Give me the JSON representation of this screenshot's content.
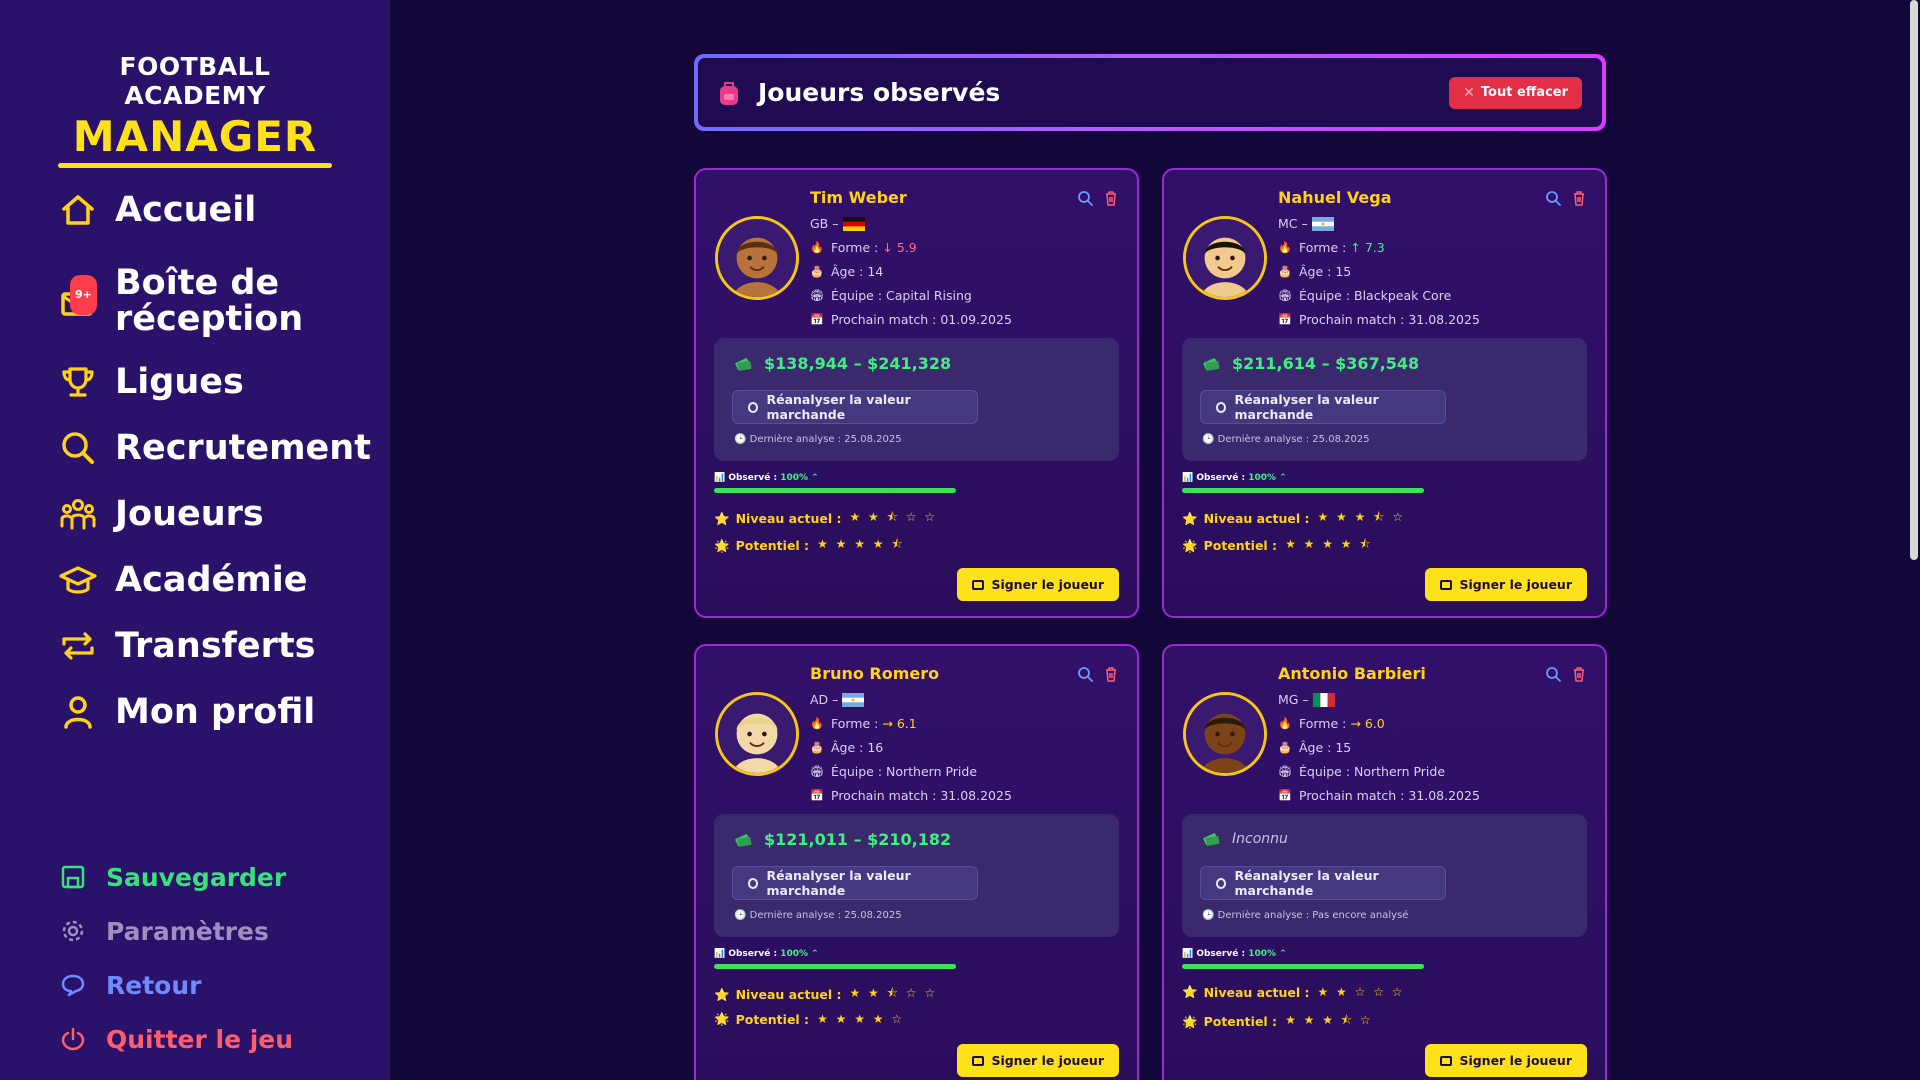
{
  "sidebar": {
    "logo_top": "FOOTBALL ACADEMY",
    "logo_main": "MANAGER",
    "nav": [
      {
        "label": "Accueil",
        "icon": "home-icon"
      },
      {
        "label": "Boîte de réception",
        "icon": "mail-icon",
        "badge": "9+"
      },
      {
        "label": "Ligues",
        "icon": "trophy-icon"
      },
      {
        "label": "Recrutement",
        "icon": "search-icon"
      },
      {
        "label": "Joueurs",
        "icon": "players-icon"
      },
      {
        "label": "Académie",
        "icon": "graduation-cap-icon"
      },
      {
        "label": "Transferts",
        "icon": "transfer-icon"
      },
      {
        "label": "Mon profil",
        "icon": "user-icon"
      }
    ],
    "bottom": [
      {
        "label": "Sauvegarder",
        "icon": "save-icon",
        "color": "#37e27a"
      },
      {
        "label": "Paramètres",
        "icon": "gear-icon",
        "color": "#9d8fc0"
      },
      {
        "label": "Retour",
        "icon": "feedback-icon",
        "color": "#6c8bff"
      },
      {
        "label": "Quitter le jeu",
        "icon": "power-icon",
        "color": "#ff5d6b"
      }
    ]
  },
  "header": {
    "title": "Joueurs observés",
    "clear_label": "Tout effacer"
  },
  "labels": {
    "forme": "Forme :",
    "age": "Âge :",
    "equipe": "Équipe :",
    "prochain": "Prochain match :",
    "reanalyze": "Réanalyser la valeur marchande",
    "derniere": "Dernière analyse :",
    "observe": "Observé :",
    "niveau": "Niveau actuel :",
    "potentiel": "Potentiel :",
    "sign": "Signer le joueur"
  },
  "players": [
    {
      "name": "Tim Weber",
      "position": "GB –",
      "flag": "germany",
      "forme_arrow": "↓",
      "forme": "5.9",
      "trend": "down",
      "age": "Âge : 14",
      "team": "Équipe : Capital Rising",
      "next_match": "Prochain match : 01.09.2025",
      "value": "$138,944 – $241,328",
      "last_analysis": "Dernière analyse : 25.08.2025",
      "observed": "100%",
      "observed_fraction": 1.0,
      "stars_current": "★ ★ ⯪ ☆ ☆",
      "stars_potential": "★ ★ ★ ★ ⯪"
    },
    {
      "name": "Nahuel Vega",
      "position": "MC –",
      "flag": "argentina",
      "forme_arrow": "↑",
      "forme": "7.3",
      "trend": "up",
      "age": "Âge : 15",
      "team": "Équipe : Blackpeak Core",
      "next_match": "Prochain match : 31.08.2025",
      "value": "$211,614 – $367,548",
      "last_analysis": "Dernière analyse : 25.08.2025",
      "observed": "100%",
      "observed_fraction": 1.0,
      "stars_current": "★ ★ ★ ⯪ ☆",
      "stars_potential": "★ ★ ★ ★ ⯪"
    },
    {
      "name": "Bruno Romero",
      "position": "AD –",
      "flag": "argentina",
      "forme_arrow": "→",
      "forme": "6.1",
      "trend": "flat",
      "age": "Âge : 16",
      "team": "Équipe : Northern Pride",
      "next_match": "Prochain match : 31.08.2025",
      "value": "$121,011 – $210,182",
      "last_analysis": "Dernière analyse : 25.08.2025",
      "observed": "100%",
      "observed_fraction": 1.0,
      "stars_current": "★ ★ ⯪ ☆ ☆",
      "stars_potential": "★ ★ ★ ★ ☆"
    },
    {
      "name": "Antonio Barbieri",
      "position": "MG –",
      "flag": "italy",
      "forme_arrow": "→",
      "forme": "6.0",
      "trend": "flat",
      "age": "Âge : 15",
      "team": "Équipe : Northern Pride",
      "next_match": "Prochain match : 31.08.2025",
      "value": "Inconnu",
      "last_analysis": "Dernière analyse : Pas encore analysé",
      "observed": "100%",
      "observed_fraction": 1.0,
      "stars_current": "★ ★ ☆ ☆ ☆",
      "stars_potential": "★ ★ ★ ⯪ ☆"
    }
  ],
  "colors": {
    "accent": "#ffe11a",
    "sidebar": "#2a1169",
    "background": "#13073a",
    "card_border": "#9a2bd0",
    "value_green": "#3ef080",
    "danger": "#e32f45"
  }
}
